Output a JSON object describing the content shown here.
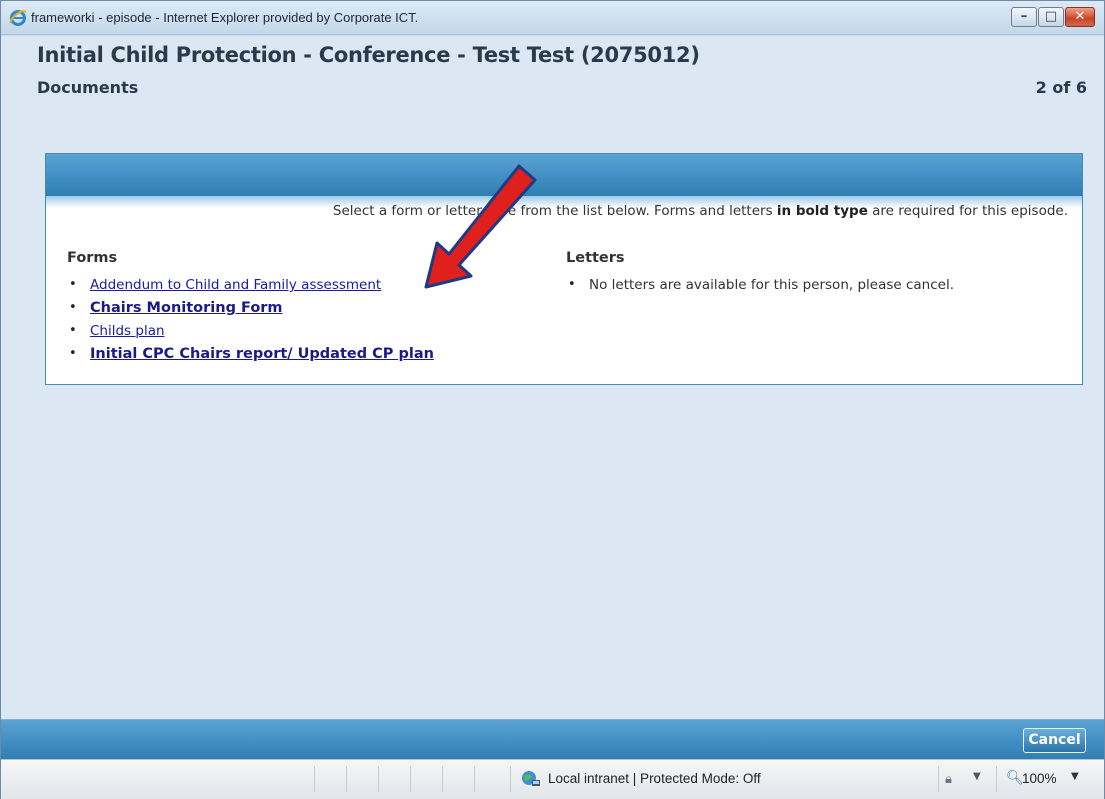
{
  "window": {
    "title": "frameworki - episode - Internet Explorer provided by Corporate ICT."
  },
  "page": {
    "title": "Initial Child Protection - Conference - Test Test (2075012)",
    "section": "Documents",
    "pager": "2 of 6"
  },
  "panel": {
    "instructions_pre": "Select a form or letter type from the list below. Forms and letters ",
    "instructions_bold": "in bold type",
    "instructions_post": " are required for this episode."
  },
  "forms": {
    "heading": "Forms",
    "items": [
      {
        "label": "Addendum to Child and Family assessment",
        "required": false
      },
      {
        "label": "Chairs Monitoring Form",
        "required": true
      },
      {
        "label": "Childs plan",
        "required": false
      },
      {
        "label": "Initial CPC Chairs report/ Updated CP plan",
        "required": true
      }
    ]
  },
  "letters": {
    "heading": "Letters",
    "empty_message": "No letters are available for this person, please cancel."
  },
  "footer": {
    "cancel_label": "Cancel"
  },
  "statusbar": {
    "zone": "Local intranet | Protected Mode: Off",
    "zoom": "100%"
  },
  "annotation": {
    "arrow_color": "#e0201c"
  },
  "icons": {
    "browser": "ie-logo-icon",
    "zone": "intranet-globe-icon",
    "security": "lock-icon",
    "zoom": "zoom-icon"
  }
}
